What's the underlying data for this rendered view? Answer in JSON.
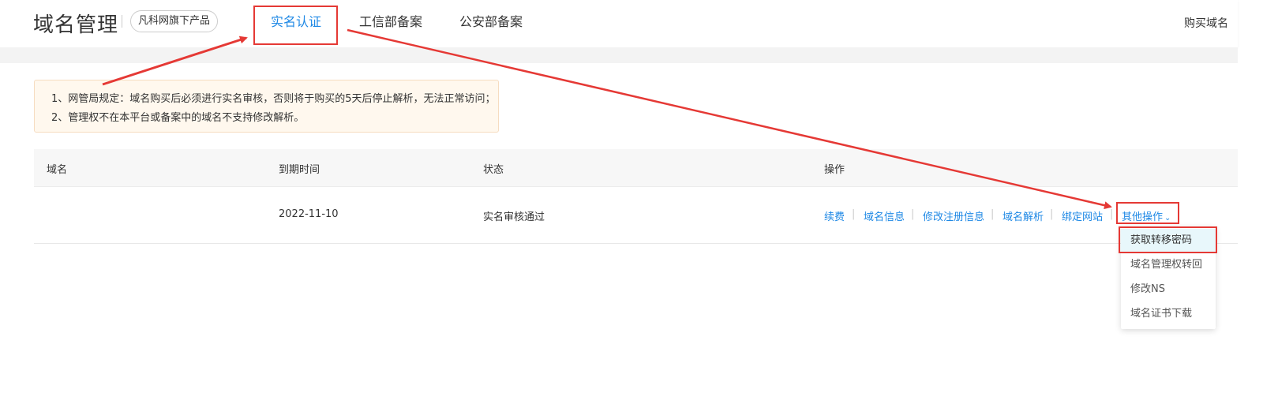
{
  "header": {
    "title": "域名管理",
    "tag": "凡科网旗下产品",
    "tabs": [
      {
        "label": "实名认证",
        "active": true
      },
      {
        "label": "工信部备案",
        "active": false
      },
      {
        "label": "公安部备案",
        "active": false
      }
    ],
    "buy_link": "购买域名"
  },
  "notice": {
    "lines": [
      "1、网管局规定：域名购买后必须进行实名审核，否则将于购买的5天后停止解析，无法正常访问；",
      "2、管理权不在本平台或备案中的域名不支持修改解析。"
    ]
  },
  "table": {
    "columns": [
      "域名",
      "到期时间",
      "状态",
      "操作"
    ],
    "rows": [
      {
        "domain": "",
        "expiry": "2022-11-10",
        "status": "实名审核通过",
        "actions": [
          "续费",
          "域名信息",
          "修改注册信息",
          "域名解析",
          "绑定网站"
        ],
        "more_actions": "其他操作"
      }
    ]
  },
  "dropdown": {
    "items": [
      "获取转移密码",
      "域名管理权转回",
      "修改NS",
      "域名证书下载"
    ],
    "highlighted_index": 0
  },
  "colors": {
    "accent": "#1e88e5",
    "annotation_red": "#e53935",
    "notice_bg": "#fff8ee"
  },
  "icons": {
    "more_actions_chevron": "chevron-down-icon"
  }
}
